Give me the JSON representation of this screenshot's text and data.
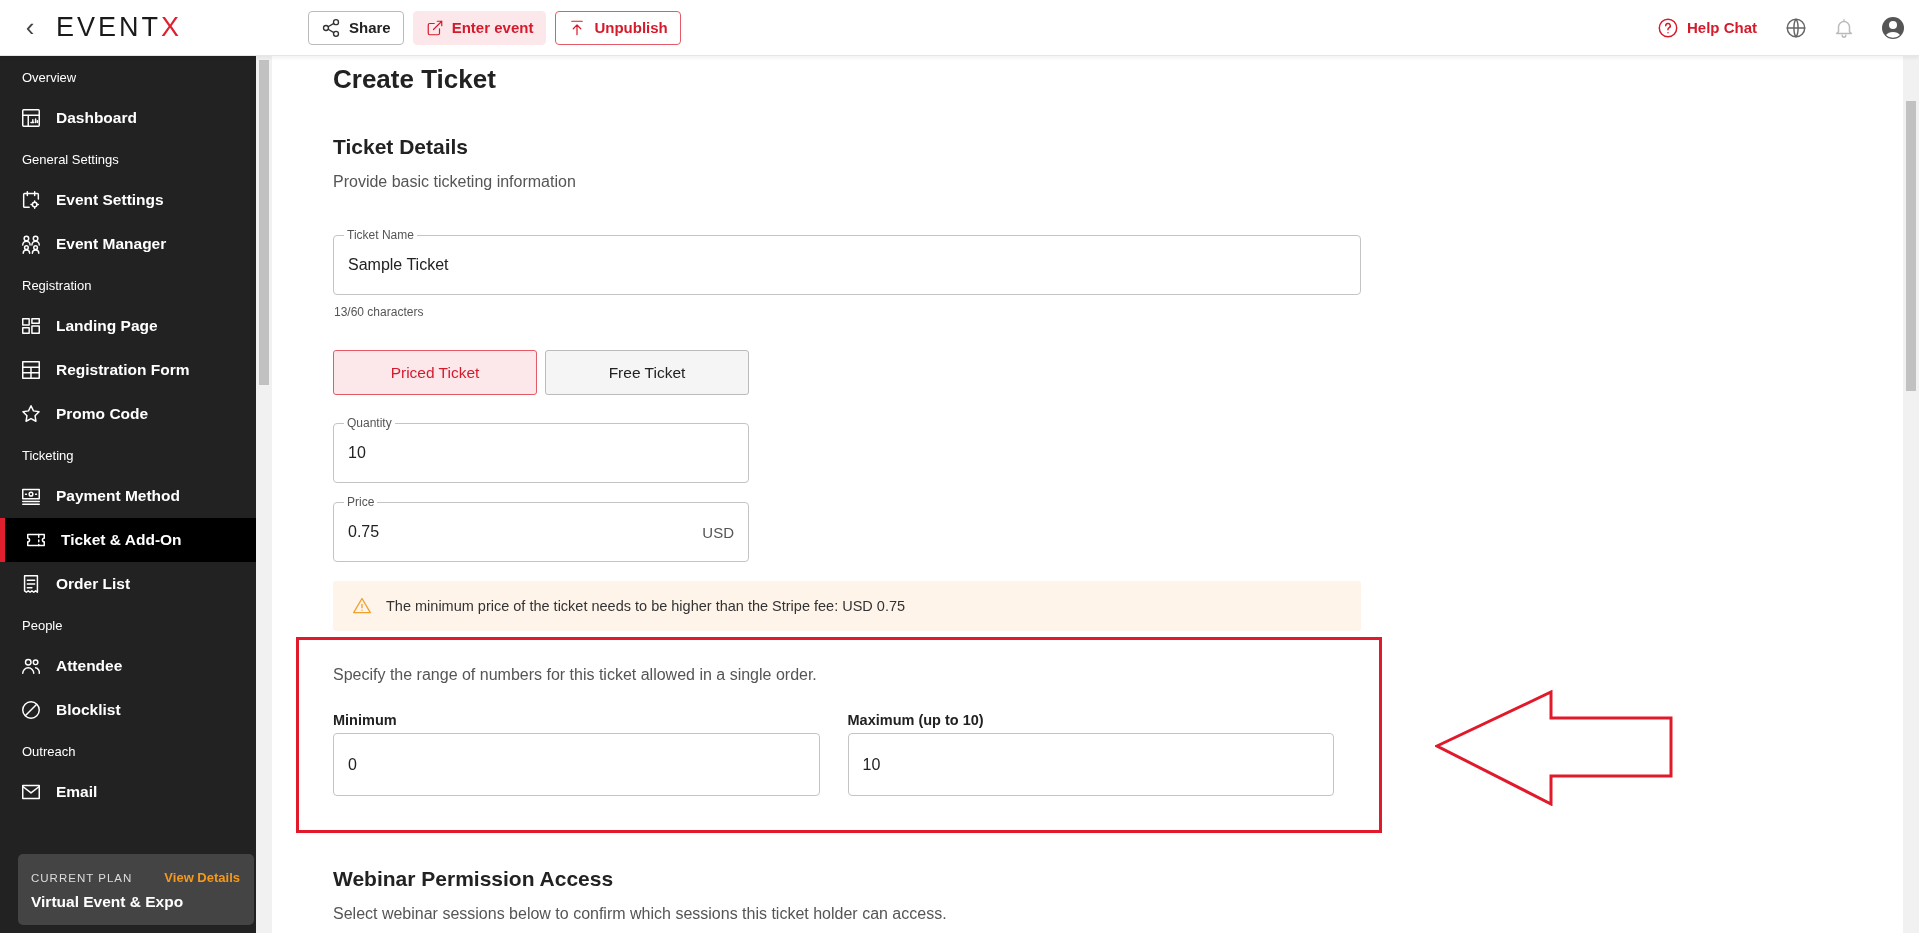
{
  "topbar": {
    "back": "‹",
    "logo_main": "EVENT",
    "logo_accent": "X",
    "actions": [
      {
        "label": "Share",
        "kind": "share"
      },
      {
        "label": "Enter event",
        "kind": "enter"
      },
      {
        "label": "Unpublish",
        "kind": "unpublish"
      }
    ],
    "help": "Help Chat"
  },
  "sidebar": {
    "sections": [
      {
        "title": "Overview",
        "items": [
          {
            "label": "Dashboard",
            "selected": false
          }
        ]
      },
      {
        "title": "General Settings",
        "items": [
          {
            "label": "Event Settings",
            "selected": false
          },
          {
            "label": "Event Manager",
            "selected": false
          }
        ]
      },
      {
        "title": "Registration",
        "items": [
          {
            "label": "Landing Page",
            "selected": false
          },
          {
            "label": "Registration Form",
            "selected": false
          },
          {
            "label": "Promo Code",
            "selected": false
          }
        ]
      },
      {
        "title": "Ticketing",
        "items": [
          {
            "label": "Payment Method",
            "selected": false
          },
          {
            "label": "Ticket & Add-On",
            "selected": true
          },
          {
            "label": "Order List",
            "selected": false
          }
        ]
      },
      {
        "title": "People",
        "items": [
          {
            "label": "Attendee",
            "selected": false
          },
          {
            "label": "Blocklist",
            "selected": false
          }
        ]
      },
      {
        "title": "Outreach",
        "items": [
          {
            "label": "Email",
            "selected": false
          }
        ]
      }
    ],
    "plan": {
      "caption": "CURRENT PLAN",
      "link": "View Details",
      "name": "Virtual Event & Expo"
    }
  },
  "page": {
    "title": "Create Ticket",
    "section_title": "Ticket Details",
    "section_subtitle": "Provide basic ticketing information",
    "ticket_name": {
      "label": "Ticket Name",
      "value": "Sample Ticket",
      "counter": "13/60 characters"
    },
    "ticket_types": [
      {
        "label": "Priced Ticket",
        "selected": true
      },
      {
        "label": "Free Ticket",
        "selected": false
      }
    ],
    "quantity": {
      "label": "Quantity",
      "value": "10"
    },
    "price": {
      "label": "Price",
      "value": "0.75",
      "currency": "USD"
    },
    "warning": "The minimum price of the ticket needs to be higher than the Stripe fee: USD 0.75",
    "range": {
      "description": "Specify the range of numbers for this ticket allowed in a single order.",
      "minimum": {
        "label": "Minimum",
        "value": "0"
      },
      "maximum": {
        "label": "Maximum (up to 10)",
        "value": "10"
      }
    },
    "webinar": {
      "title": "Webinar Permission Access",
      "subtitle": "Select webinar sessions below to confirm which sessions this ticket holder can access."
    }
  }
}
